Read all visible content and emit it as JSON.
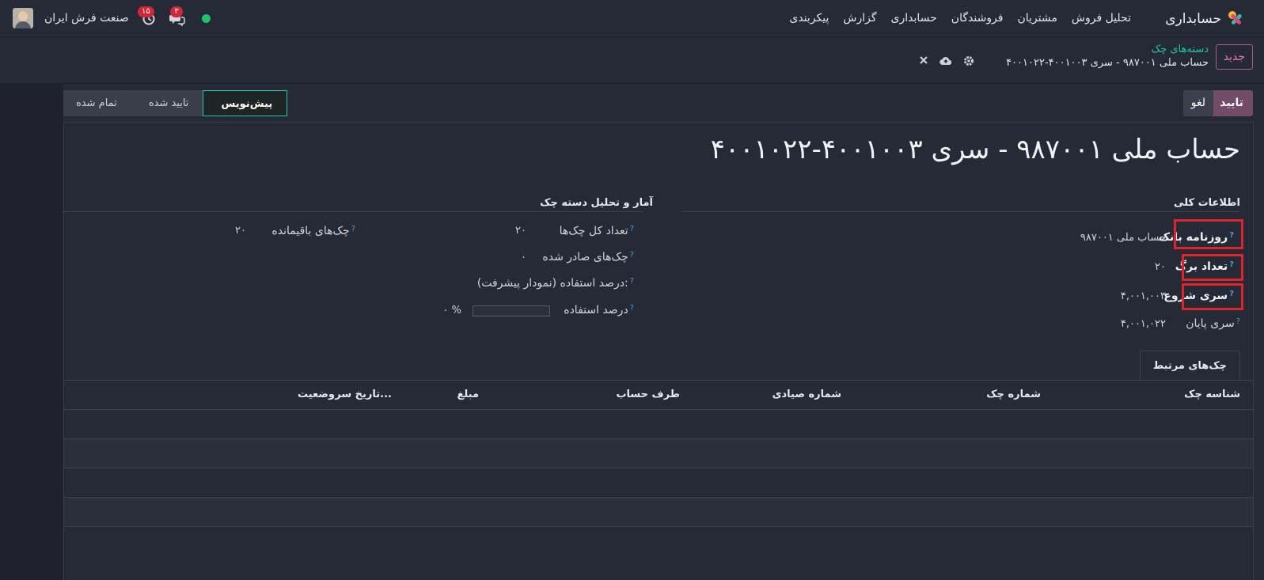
{
  "topbar": {
    "app_name": "حسابداری",
    "menu": [
      "تحلیل فروش",
      "مشتریان",
      "فروشندگان",
      "حسابداری",
      "گزارش",
      "پیکربندی"
    ],
    "company": "صنعت فرش ایران",
    "activity_badge": "۱۵",
    "messages_badge": "۳",
    "online_color": "#21c16a"
  },
  "control": {
    "new_label": "جدید",
    "breadcrumb_parent": "دسته‌های چک",
    "breadcrumb_current": "حساب ملی ۹۸۷۰۰۱ - سری ۴۰۰۱۰۰۳-۴۰۰۱۰۲۲"
  },
  "actions": {
    "confirm_label": "تایید",
    "cancel_label": "لغو",
    "stages": [
      "تمام شده",
      "تایید شده",
      "پیش‌نویس"
    ],
    "active_stage": "پیش‌نویس"
  },
  "form": {
    "title": "حساب ملی ۹۸۷۰۰۱ - سری ۴۰۰۱۰۰۳-۴۰۰۱۰۲۲",
    "general_group": "اطلاعات کلی",
    "stats_group": "آمار و تحلیل دسته چک",
    "bank_journal_label": "روزنامه بانک",
    "bank_journal_value": "حساب ملی ۹۸۷۰۰۱",
    "leaf_count_label": "تعداد برگ",
    "leaf_count_value": "۲۰",
    "start_series_label": "سری شروع",
    "start_series_value": "۴,۰۰۱,۰۰۳",
    "end_series_label": "سری پایان",
    "end_series_value": "۴,۰۰۱,۰۲۲",
    "total_checks_label": "تعداد کل چک‌ها",
    "total_checks_value": "۲۰",
    "remaining_checks_label": "چک‌های باقیمانده",
    "remaining_checks_value": "۲۰",
    "issued_checks_label": "چک‌های صادر شده",
    "issued_checks_value": "۰",
    "usage_chart_label": "درصد استفاده (نمودار پیشرفت):",
    "usage_percent_label": "درصد استفاده",
    "usage_percent_value": "۰ %",
    "usage_fraction": 0,
    "help_mark": "?"
  },
  "tab": {
    "label": "چک‌های مرتبط"
  },
  "table": {
    "columns": [
      "شناسه چک",
      "شماره چک",
      "شماره صیادی",
      "طرف حساب",
      "مبلغ",
      "تاریخ سر...",
      "وضعیت"
    ]
  },
  "colors": {
    "accent": "#714b67",
    "teal": "#1fc6a8",
    "highlight": "#e0242e"
  }
}
